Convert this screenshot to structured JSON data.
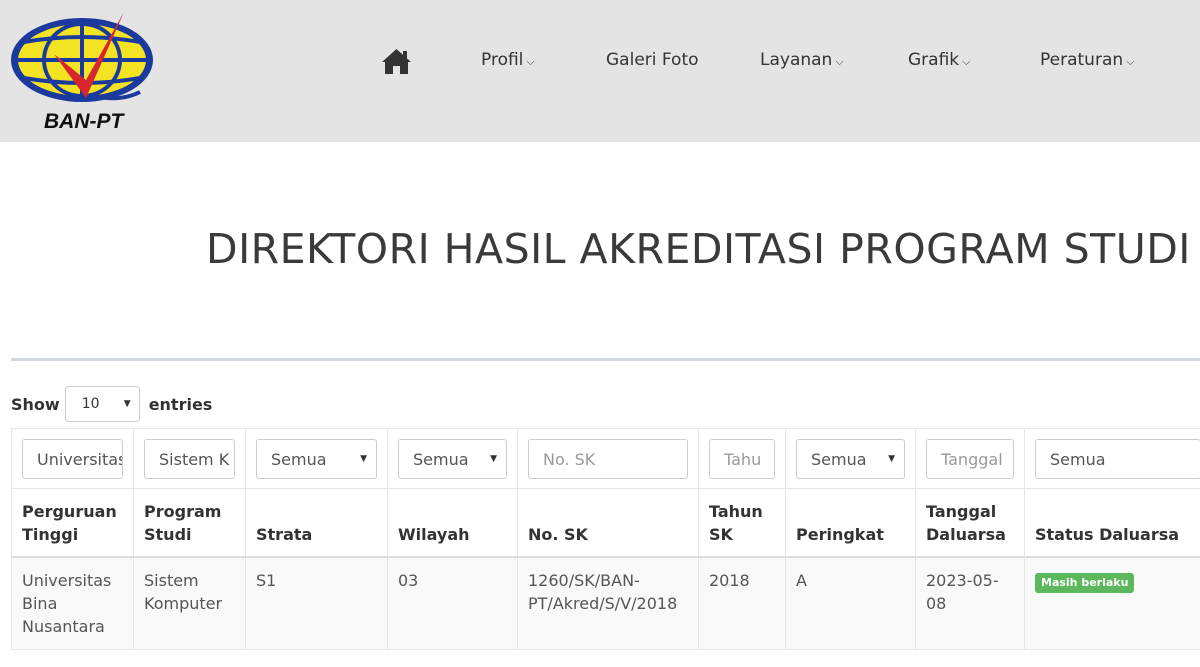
{
  "header": {
    "logo_text": "BAN-PT",
    "nav": [
      {
        "label": "Profil",
        "dropdown": true
      },
      {
        "label": "Galeri Foto",
        "dropdown": false
      },
      {
        "label": "Layanan",
        "dropdown": true
      },
      {
        "label": "Grafik",
        "dropdown": true
      },
      {
        "label": "Peraturan",
        "dropdown": true
      }
    ],
    "caret": "⌵"
  },
  "page": {
    "title": "DIREKTORI HASIL AKREDITASI PROGRAM STUDI"
  },
  "table_controls": {
    "show_label": "Show",
    "entries_value": "10",
    "entries_label": "entries"
  },
  "filters": {
    "perguruan_tinggi": "Universitas",
    "program_studi": "Sistem K",
    "strata": "Semua",
    "wilayah": "Semua",
    "no_sk": "No. SK",
    "tahun_sk": "Tahu",
    "peringkat": "Semua",
    "tanggal_daluarsa": "Tanggal",
    "status_daluarsa": "Semua"
  },
  "columns": {
    "perguruan_tinggi": "Perguruan Tinggi",
    "program_studi": "Program Studi",
    "strata": "Strata",
    "wilayah": "Wilayah",
    "no_sk": "No. SK",
    "tahun_sk": "Tahun SK",
    "peringkat": "Peringkat",
    "tanggal_daluarsa": "Tanggal Daluarsa",
    "status_daluarsa": "Status Daluarsa"
  },
  "rows": [
    {
      "perguruan_tinggi": "Universitas Bina Nusantara",
      "program_studi": "Sistem Komputer",
      "strata": "S1",
      "wilayah": "03",
      "no_sk": "1260/SK/BAN-PT/Akred/S/V/2018",
      "tahun_sk": "2018",
      "peringkat": "A",
      "tanggal_daluarsa": "2023-05-08",
      "status_daluarsa": "Masih berlaku"
    }
  ],
  "colors": {
    "header_bg": "#e4e4e4",
    "badge_green": "#5cb85c",
    "logo_yellow": "#f3e322",
    "logo_blue": "#1b3a9e",
    "logo_red": "#d7262d"
  }
}
